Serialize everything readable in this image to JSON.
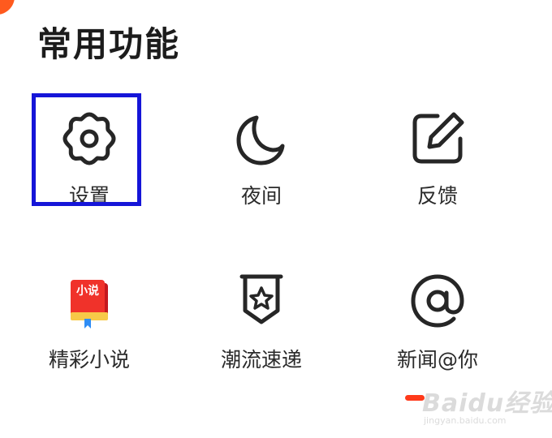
{
  "section": {
    "title": "常用功能"
  },
  "items": [
    {
      "label": "设置",
      "icon": "gear-icon",
      "selected": true
    },
    {
      "label": "夜间",
      "icon": "moon-icon"
    },
    {
      "label": "反馈",
      "icon": "edit-icon"
    },
    {
      "label": "精彩小说",
      "icon": "novel-book-icon",
      "icon_text": "小说"
    },
    {
      "label": "潮流速递",
      "icon": "star-badge-icon"
    },
    {
      "label": "新闻@你",
      "icon": "at-sign-icon"
    }
  ],
  "watermark": {
    "main": "Baidu经验",
    "sub": "jingyan.baidu.com"
  },
  "colors": {
    "accent": "#ff5a1e",
    "highlight": "#1515d8",
    "text": "#2a2a2a",
    "indicator": "#ff3a1a"
  }
}
